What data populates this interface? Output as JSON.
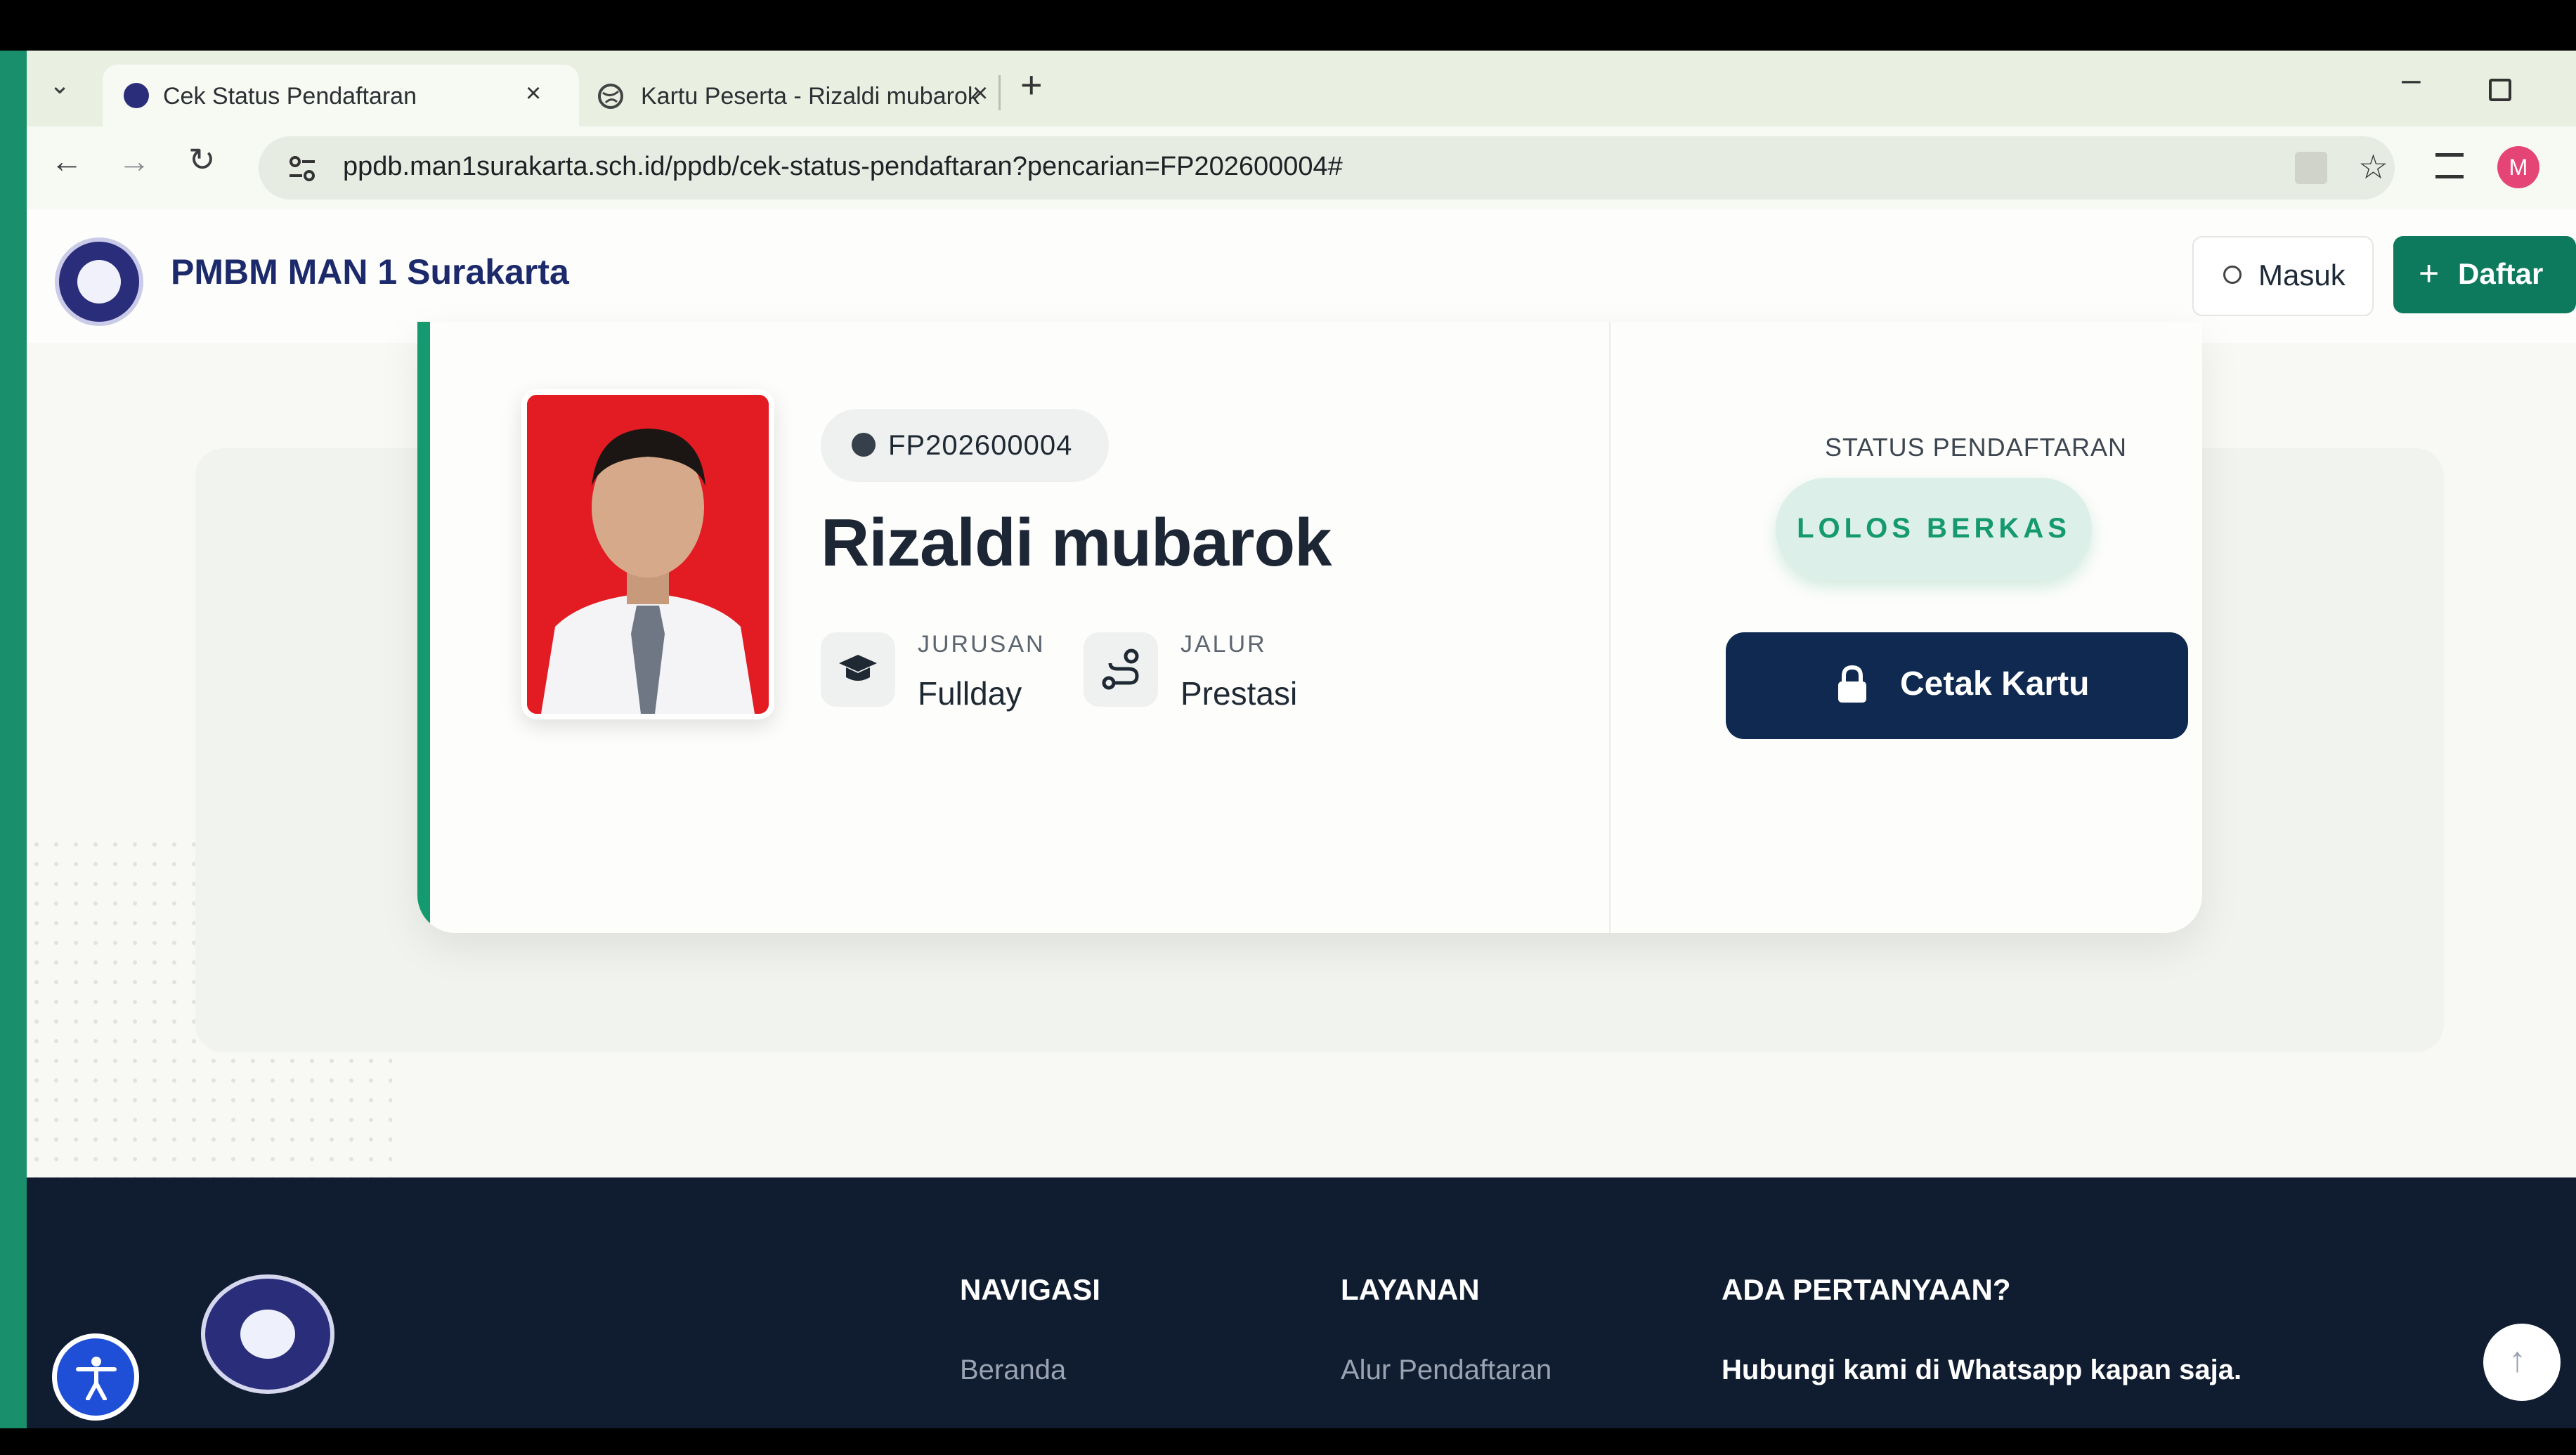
{
  "browser": {
    "tabs": [
      {
        "title": "Cek Status Pendaftaran",
        "active": true
      },
      {
        "title": "Kartu Peserta - Rizaldi mubarok",
        "active": false
      }
    ],
    "url": "ppdb.man1surakarta.sch.id/ppdb/cek-status-pendaftaran?pencarian=FP202600004#",
    "profile_initial": "M"
  },
  "site": {
    "brand": "PMBM MAN 1 Surakarta",
    "login_label": "Masuk",
    "register_label": "Daftar"
  },
  "registrant": {
    "id": "FP202600004",
    "name": "Rizaldi mubarok",
    "major_label": "JURUSAN",
    "major_value": "Fullday",
    "path_label": "JALUR",
    "path_value": "Prestasi",
    "status_label": "STATUS PENDAFTARAN",
    "status_value": "LOLOS BERKAS",
    "print_button": "Cetak Kartu"
  },
  "footer": {
    "nav_heading": "NAVIGASI",
    "nav_link": "Beranda",
    "service_heading": "LAYANAN",
    "service_link": "Alur Pendaftaran",
    "question_heading": "ADA PERTANYAAN?",
    "question_text": "Hubungi kami di Whatsapp kapan saja."
  },
  "colors": {
    "accent_green": "#15996f",
    "navy": "#0f2950",
    "footer_bg": "#101c30"
  }
}
